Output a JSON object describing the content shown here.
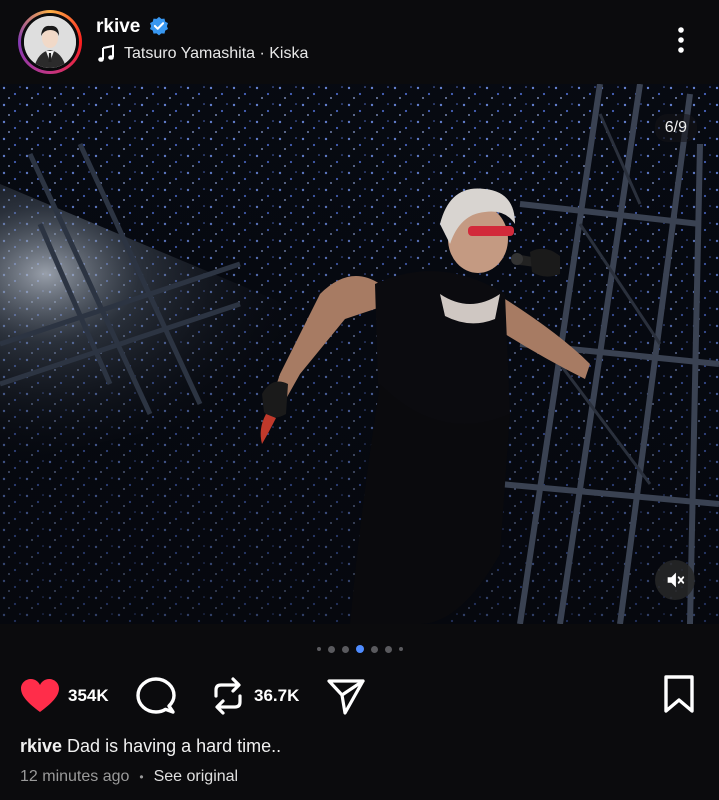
{
  "post": {
    "username": "rkive",
    "verified": true,
    "song": "Tatsuro Yamashita · Kiska",
    "page_counter": "6/9",
    "carousel": {
      "total_dots": 7,
      "active_index": 3
    },
    "likes": "354K",
    "reposts": "36.7K",
    "liked": true,
    "caption_user": "rkive",
    "caption_text": " Dad is having a hard time..",
    "timestamp": "12 minutes ago",
    "separator": "•",
    "see_original": "See original"
  },
  "icons": {
    "verified": "verified-badge-icon",
    "music": "music-note-icon",
    "more": "more-vertical-icon",
    "mute": "speaker-muted-icon",
    "like": "heart-filled-icon",
    "comment": "comment-icon",
    "repost": "repost-icon",
    "share": "send-icon",
    "bookmark": "bookmark-icon"
  },
  "colors": {
    "background": "#0b0b0d",
    "heart": "#ff2d4a",
    "verified": "#3897f0",
    "active_dot": "#4f8cff"
  }
}
